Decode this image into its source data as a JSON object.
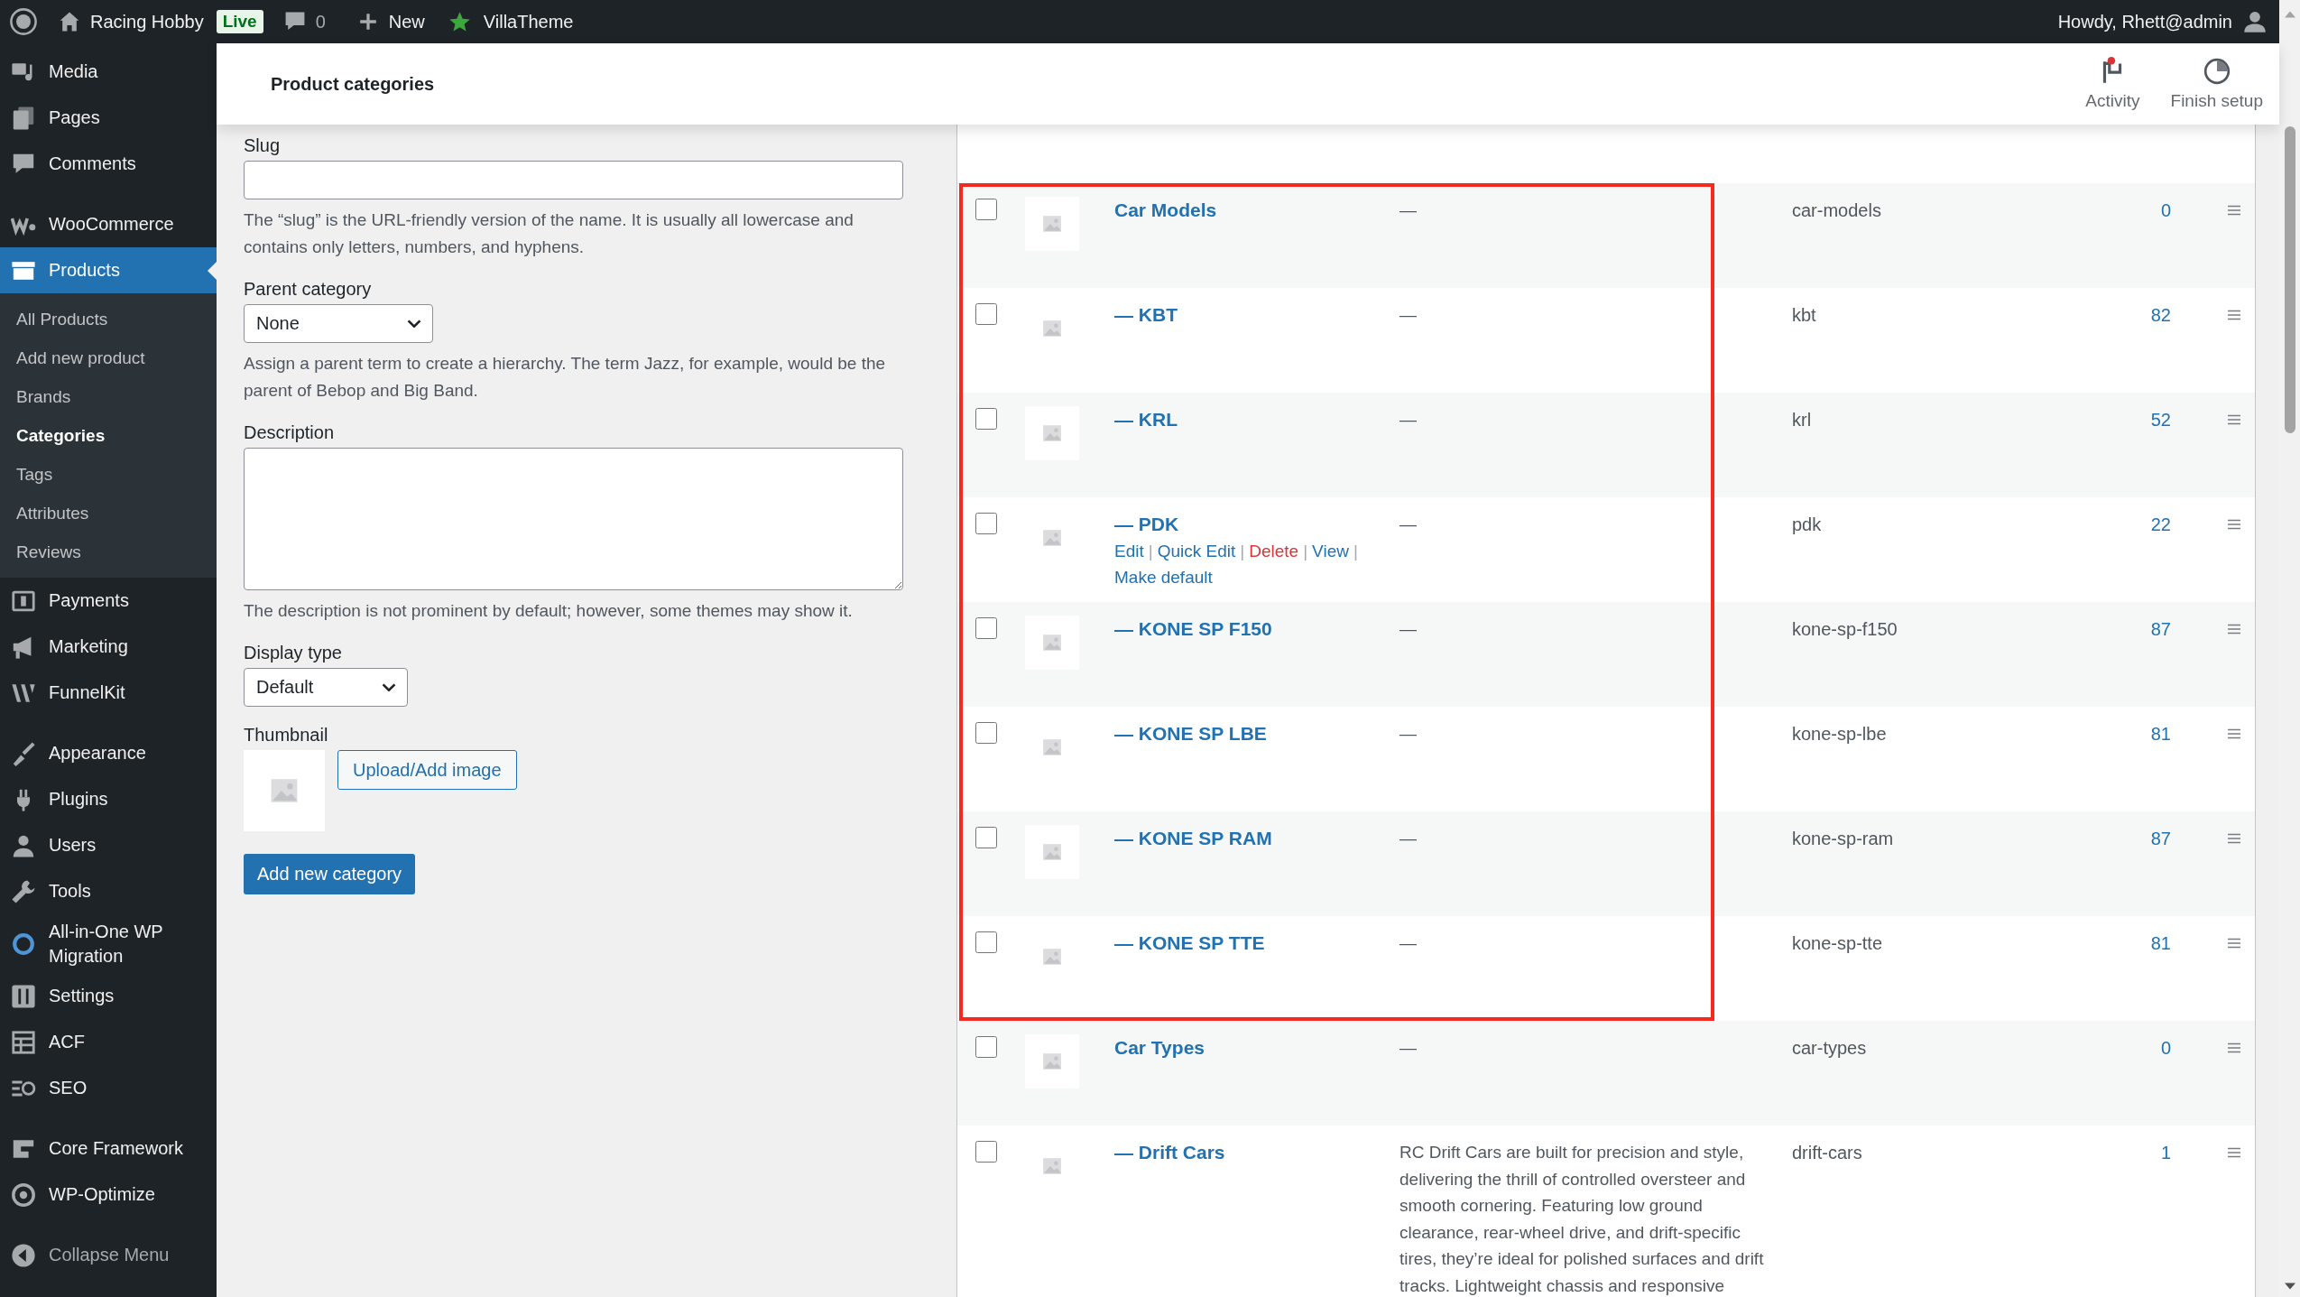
{
  "admin_bar": {
    "site": "Racing Hobby",
    "badge": "Live",
    "comments": "0",
    "new": "New",
    "plugin": "VillaTheme",
    "greeting": "Howdy, Rhett@admin"
  },
  "sidebar": {
    "groups": [
      [
        {
          "label": "Media",
          "selected": false
        },
        {
          "label": "Pages",
          "selected": false
        },
        {
          "label": "Comments",
          "selected": false
        }
      ],
      [
        {
          "label": "WooCommerce",
          "selected": false
        },
        {
          "label": "Products",
          "selected": true,
          "children": [
            {
              "label": "All Products",
              "selected": false
            },
            {
              "label": "Add new product",
              "selected": false
            },
            {
              "label": "Brands",
              "selected": false
            },
            {
              "label": "Categories",
              "selected": true
            },
            {
              "label": "Tags",
              "selected": false
            },
            {
              "label": "Attributes",
              "selected": false
            },
            {
              "label": "Reviews",
              "selected": false
            }
          ]
        },
        {
          "label": "Payments",
          "selected": false
        },
        {
          "label": "Marketing",
          "selected": false
        },
        {
          "label": "FunnelKit",
          "selected": false
        }
      ],
      [
        {
          "label": "Appearance",
          "selected": false
        },
        {
          "label": "Plugins",
          "selected": false
        },
        {
          "label": "Users",
          "selected": false
        },
        {
          "label": "Tools",
          "selected": false
        },
        {
          "label": "All-in-One WP Migration",
          "selected": false
        },
        {
          "label": "Settings",
          "selected": false
        },
        {
          "label": "ACF",
          "selected": false
        },
        {
          "label": "SEO",
          "selected": false
        }
      ],
      [
        {
          "label": "Core Framework",
          "selected": false
        },
        {
          "label": "WP-Optimize",
          "selected": false
        }
      ]
    ],
    "collapse": "Collapse Menu"
  },
  "header": {
    "title": "Product categories",
    "actions": [
      {
        "label": "Activity",
        "notification": true
      },
      {
        "label": "Finish setup",
        "notification": false
      }
    ]
  },
  "form": {
    "fields": [
      {
        "kind": "text",
        "label": "Slug",
        "help": "The “slug” is the URL-friendly version of the name. It is usually all lowercase and contains only letters, numbers, and hyphens."
      },
      {
        "kind": "select",
        "label": "Parent category",
        "value": "None",
        "help": "Assign a parent term to create a hierarchy. The term Jazz, for example, would be the parent of Bebop and Big Band."
      },
      {
        "kind": "textarea",
        "label": "Description",
        "help": "The description is not prominent by default; however, some themes may show it."
      },
      {
        "kind": "select",
        "label": "Display type",
        "value": "Default"
      },
      {
        "kind": "thumbnail",
        "label": "Thumbnail",
        "button": "Upload/Add image"
      }
    ],
    "submit": "Add new category"
  },
  "table": {
    "sections": [
      {
        "highlighted": true,
        "rows": [
          {
            "name": "Car Models",
            "description": "—",
            "slug": "car-models",
            "count": "0",
            "checked": false
          },
          {
            "name": "— KBT",
            "description": "—",
            "slug": "kbt",
            "count": "82",
            "checked": false
          },
          {
            "name": "— KRL",
            "description": "—",
            "slug": "krl",
            "count": "52",
            "checked": false
          },
          {
            "name": "— PDK",
            "description": "—",
            "slug": "pdk",
            "count": "22",
            "checked": false,
            "actions": [
              {
                "label": "Edit",
                "kind": "link",
                "separator": "|"
              },
              {
                "label": "Quick Edit",
                "kind": "link",
                "separator": "|"
              },
              {
                "label": "Delete",
                "kind": "delete",
                "separator": "|"
              },
              {
                "label": "View",
                "kind": "link",
                "separator": "|"
              },
              {
                "label": "Make default",
                "kind": "link"
              }
            ]
          },
          {
            "name": "— KONE SP F150",
            "description": "—",
            "slug": "kone-sp-f150",
            "count": "87",
            "checked": false
          },
          {
            "name": "— KONE SP LBE",
            "description": "—",
            "slug": "kone-sp-lbe",
            "count": "81",
            "checked": false
          },
          {
            "name": "— KONE SP RAM",
            "description": "—",
            "slug": "kone-sp-ram",
            "count": "87",
            "checked": false
          },
          {
            "name": "— KONE SP TTE",
            "description": "—",
            "slug": "kone-sp-tte",
            "count": "81",
            "checked": false
          }
        ]
      },
      {
        "rows": [
          {
            "name": "Car Types",
            "description": "—",
            "slug": "car-types",
            "count": "0",
            "checked": false
          },
          {
            "name": "— Drift Cars",
            "description": "RC Drift Cars are built for precision and style, delivering the thrill of controlled oversteer and smooth cornering. Featuring low ground clearance, rear-wheel drive, and drift-specific tires, they’re ideal for polished surfaces and drift tracks. Lightweight chassis and responsive",
            "slug": "drift-cars",
            "count": "1",
            "checked": false
          }
        ]
      }
    ]
  }
}
